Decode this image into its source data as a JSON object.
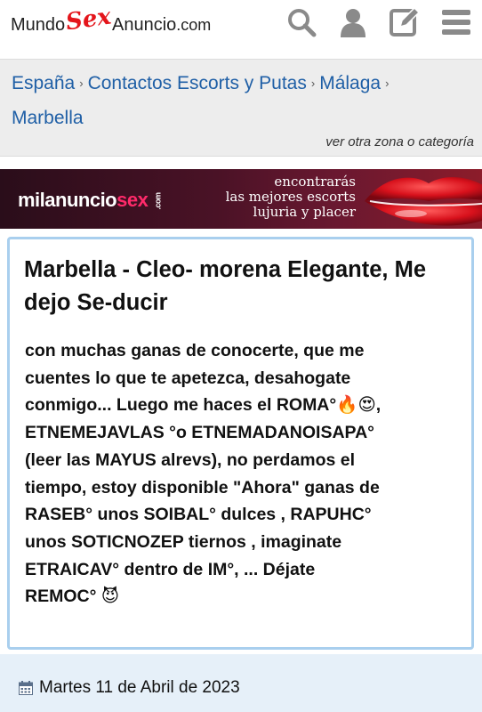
{
  "header": {
    "logo": {
      "part1": "Mundo",
      "part2": "Sex",
      "part3": "Anuncio",
      "part4": ".com"
    },
    "icons": [
      "search-icon",
      "user-icon",
      "edit-icon",
      "menu-icon"
    ]
  },
  "breadcrumb": {
    "items": [
      "España",
      "Contactos Escorts y Putas",
      "Málaga",
      "Marbella"
    ],
    "separator": "›",
    "other_zone": "ver otra zona o categoría"
  },
  "banner": {
    "brand_main": "milanuncio",
    "brand_sex": "sex",
    "brand_com": ".com",
    "tagline_1": "encontrarás",
    "tagline_2": "las mejores escorts",
    "tagline_3": "lujuria y placer"
  },
  "ad": {
    "title": "Marbella - Cleo- morena Elegante, Me dejo Se-ducir",
    "body": "con muchas ganas de conocerte, que me\ncuentes lo que te apetezca, desahogate\nconmigo... Luego me haces el ROMA°🔥😍,\nETNEMEJAVLAS °o  ETNEMADANOISAPA°\n(leer las MAYUS alrevs),  no perdamos el\ntiempo, estoy disponible \"Ahora\" ganas de\nRASEB° unos SOIBAL° dulces , RAPUHC°\nunos SOTICNOZEP tiernos , imaginate\nETRAICAV° dentro de IM°, ... Déjate\nREMOC°  😈",
    "date": "Martes 11 de Abril de 2023"
  },
  "colors": {
    "link": "#1f5fa6",
    "logo_red": "#e4151b",
    "card_border": "#a9cfee",
    "date_bar_bg": "#e6f0f9",
    "crumb_bg": "#ededed"
  }
}
